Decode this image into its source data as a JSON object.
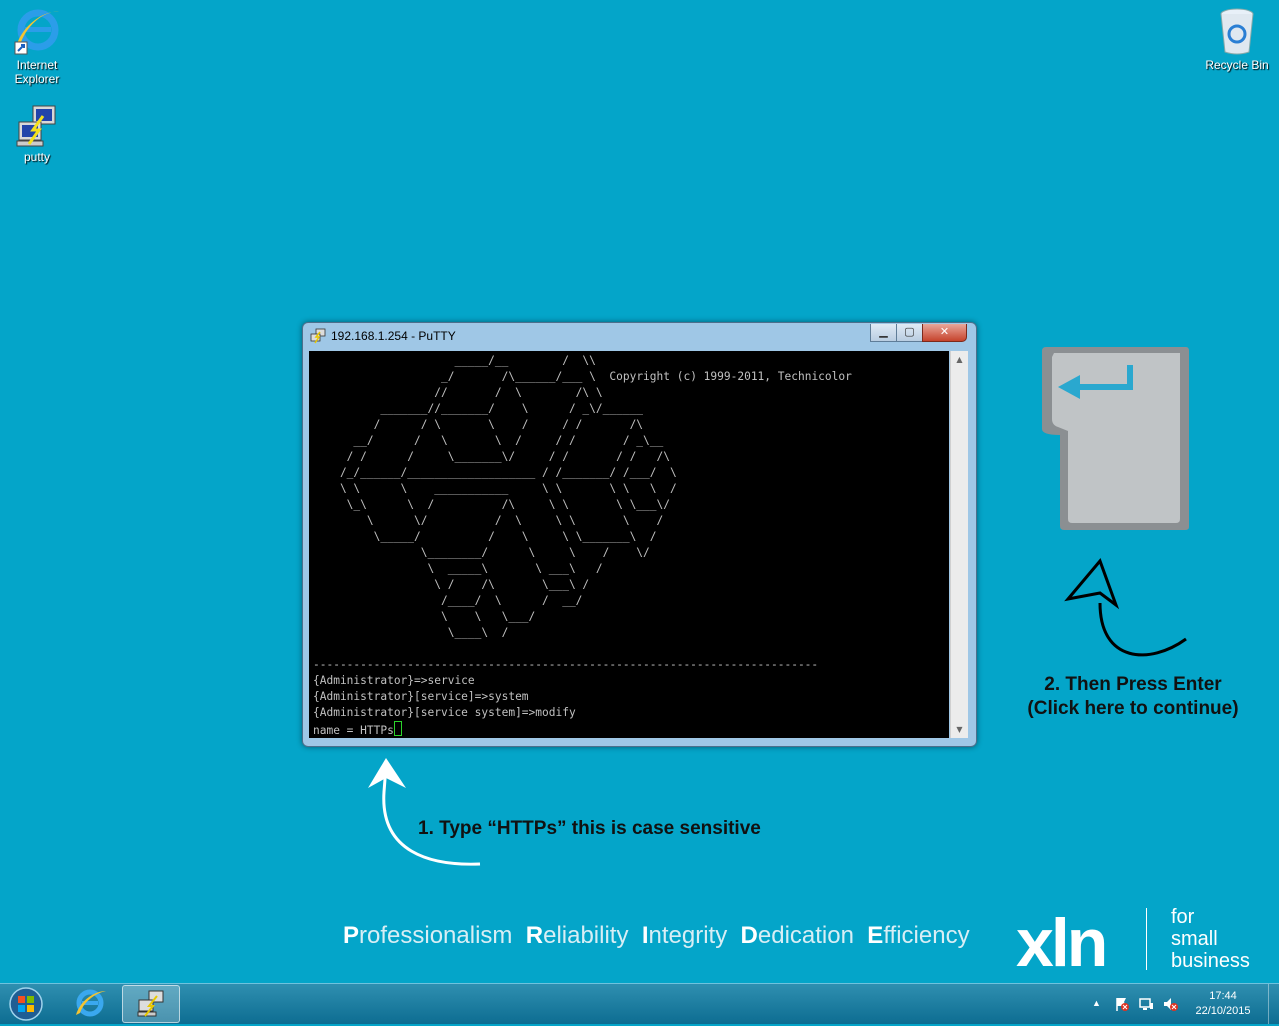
{
  "desktop": {
    "icons": [
      {
        "label": "Internet Explorer"
      },
      {
        "label": "putty"
      },
      {
        "label": "Recycle Bin"
      }
    ]
  },
  "putty": {
    "title": "192.168.1.254 - PuTTY",
    "copyright": "Copyright (c) 1999-2011, Technicolor",
    "separator": "---------------------------------------------------------------------------",
    "lines": [
      "{Administrator}=>service",
      "{Administrator}[service]=>system",
      "{Administrator}[service system]=>modify"
    ],
    "input_prompt": "name = HTTPs"
  },
  "instructions": {
    "step1": "1. Type “HTTPs” this is case sensitive",
    "step2_line1": "2. Then Press Enter",
    "step2_line2": "(Click here to continue)"
  },
  "branding": {
    "values": [
      "Professionalism",
      "Reliability",
      "Integrity",
      "Dedication",
      "Efficiency"
    ],
    "logo": "xln",
    "tagline": [
      "for",
      "small",
      "business"
    ]
  },
  "taskbar": {
    "time": "17:44",
    "date": "22/10/2015"
  },
  "colors": {
    "desktop": "#04a5c9",
    "terminal_bg": "#000000",
    "terminal_fg": "#c0c0c0",
    "cursor": "#2bd42b"
  }
}
